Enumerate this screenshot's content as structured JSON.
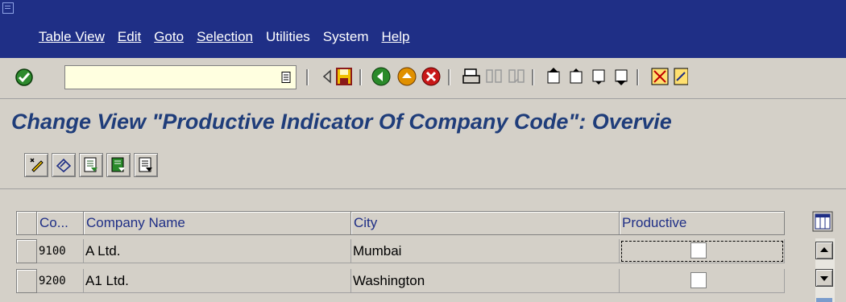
{
  "menubar": {
    "items": [
      "Table View",
      "Edit",
      "Goto",
      "Selection",
      "Utilities",
      "System",
      "Help"
    ],
    "underlined": [
      true,
      true,
      true,
      true,
      false,
      false,
      true
    ]
  },
  "toolbar": {
    "command_value": "",
    "icons": [
      "enter-icon",
      "back-triangle-icon",
      "save-icon",
      "back-icon",
      "exit-icon",
      "cancel-icon",
      "print-icon",
      "find-icon",
      "find-next-icon",
      "first-page-icon",
      "previous-page-icon",
      "next-page-icon",
      "last-page-icon",
      "create-session-icon",
      "shortcut-icon"
    ]
  },
  "screen": {
    "title": "Change View \"Productive Indicator Of Company Code\": Overvie"
  },
  "app_toolbar": {
    "icons": [
      "display-change-icon",
      "undo-icon",
      "select-all-icon",
      "select-block-icon",
      "deselect-all-icon"
    ]
  },
  "table": {
    "columns": [
      "Co...",
      "Company Name",
      "City",
      "Productive"
    ],
    "rows": [
      {
        "code": "9100",
        "name": "A Ltd.",
        "city": "Mumbai",
        "productive": false
      },
      {
        "code": "9200",
        "name": "A1 Ltd.",
        "city": "Washington",
        "productive": false
      }
    ]
  },
  "colors": {
    "menubar": "#1f2f86",
    "title": "#1f3d7a",
    "background": "#d4d0c8"
  }
}
